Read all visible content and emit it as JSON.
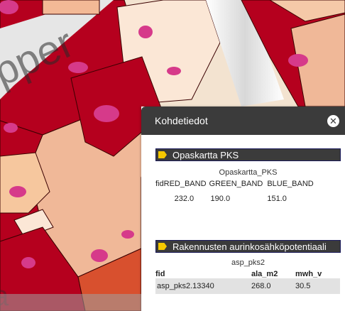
{
  "panel": {
    "title": "Kohdetiedot",
    "close_icon": "close-icon"
  },
  "layers": [
    {
      "name": "Opaskartta  PKS",
      "sub_title": "Opaskartta_PKS",
      "columns": [
        "fid",
        "RED_BAND",
        "GREEN_BAND",
        "BLUE_BAND"
      ],
      "row": [
        "",
        "232.0",
        "190.0",
        "151.0"
      ]
    },
    {
      "name": "Rakennusten aurinkosähköpotentiaali",
      "sub_title": "asp_pks2",
      "columns": [
        "fid",
        "ala_m2",
        "mwh_v"
      ],
      "row": [
        "asp_pks2.13340",
        "268.0",
        "30.5"
      ]
    }
  ],
  "colors": {
    "header_bg": "#3b3b3b",
    "marker": "#f5c800",
    "building_fill": "#f0b898",
    "dark_red": "#b5001e",
    "magenta": "#d63a8a"
  }
}
